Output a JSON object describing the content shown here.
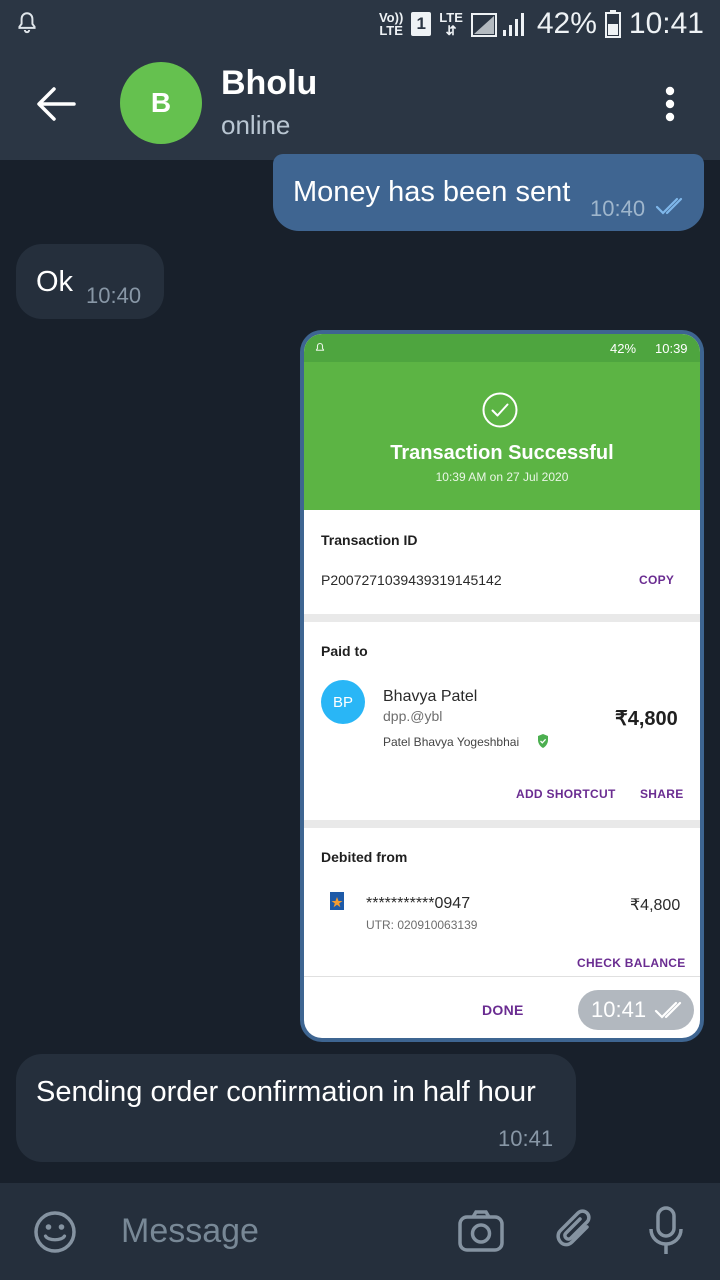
{
  "status_bar": {
    "volte_top": "Vo))",
    "volte_bottom": "LTE",
    "sim": "1",
    "lte": "LTE",
    "battery": "42%",
    "time": "10:41"
  },
  "header": {
    "avatar_letter": "B",
    "name": "Bholu",
    "status": "online"
  },
  "messages": [
    {
      "dir": "out",
      "text": "Money has been sent",
      "time": "10:40"
    },
    {
      "dir": "in",
      "text": "Ok",
      "time": "10:40"
    },
    {
      "dir": "out",
      "kind": "image",
      "time": "10:41"
    },
    {
      "dir": "in",
      "text": "Sending order confirmation in half hour",
      "time": "10:41"
    }
  ],
  "screenshot": {
    "status_bar": {
      "battery": "42%",
      "time": "10:39"
    },
    "title": "Transaction Successful",
    "date": "10:39 AM on 27 Jul 2020",
    "txn_label": "Transaction ID",
    "txn_id": "P2007271039439319145142",
    "copy": "COPY",
    "paid_to_label": "Paid to",
    "payee_initials": "BP",
    "payee_name": "Bhavya Patel",
    "payee_upi": "dpp.@ybl",
    "payee_verified_name": "Patel Bhavya Yogeshbhai",
    "amount": "₹4,800",
    "add_shortcut": "ADD SHORTCUT",
    "share": "SHARE",
    "debited_label": "Debited from",
    "account": "***********0947",
    "utr": "UTR: 020910063139",
    "debited_amount": "₹4,800",
    "check_balance": "CHECK BALANCE",
    "done": "DONE"
  },
  "composer": {
    "placeholder": "Message"
  },
  "colors": {
    "background": "#18202b",
    "appbar": "#2b3644",
    "outgoing_bubble": "#3f6591",
    "incoming_bubble": "#252f3c",
    "success_green": "#5cb444",
    "accent_purple": "#6a2c91",
    "avatar_green": "#65c14f"
  },
  "icons": [
    "bell-icon",
    "back-arrow-icon",
    "more-vert-icon",
    "read-checks-icon",
    "check-circle-icon",
    "verified-shield-icon",
    "bank-icon",
    "emoji-icon",
    "camera-icon",
    "attach-icon",
    "mic-icon"
  ]
}
